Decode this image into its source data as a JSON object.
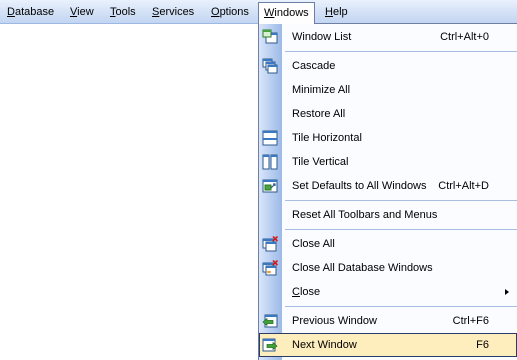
{
  "menubar": {
    "items": [
      {
        "label": "Database",
        "accel": "D",
        "rest": "atabase"
      },
      {
        "label": "View",
        "accel": "V",
        "rest": "iew"
      },
      {
        "label": "Tools",
        "accel": "T",
        "rest": "ools"
      },
      {
        "label": "Services",
        "accel": "S",
        "rest": "ervices"
      },
      {
        "label": "Options",
        "accel": "O",
        "rest": "ptions"
      },
      {
        "label": "Windows",
        "accel": "W",
        "rest": "indows"
      },
      {
        "label": "Help",
        "accel": "H",
        "rest": "elp"
      }
    ]
  },
  "windows_menu": {
    "window_list": {
      "label": "Window List",
      "shortcut": "Ctrl+Alt+0",
      "icon": "window-list-icon"
    },
    "cascade": {
      "label": "Cascade",
      "icon": "cascade-icon"
    },
    "minimize_all": {
      "label": "Minimize All"
    },
    "restore_all": {
      "label": "Restore All"
    },
    "tile_horizontal": {
      "label": "Tile Horizontal",
      "icon": "tile-horizontal-icon"
    },
    "tile_vertical": {
      "label": "Tile Vertical",
      "icon": "tile-vertical-icon"
    },
    "set_defaults": {
      "label": "Set Defaults to All Windows",
      "shortcut": "Ctrl+Alt+D",
      "icon": "set-defaults-icon"
    },
    "reset_toolbars": {
      "label": "Reset All Toolbars and Menus"
    },
    "close_all": {
      "label": "Close All",
      "icon": "close-all-icon"
    },
    "close_all_db": {
      "label": "Close All Database Windows",
      "icon": "close-all-database-icon"
    },
    "close": {
      "label": "Close",
      "accel": "C",
      "rest": "lose"
    },
    "previous_window": {
      "label": "Previous Window",
      "shortcut": "Ctrl+F6",
      "icon": "previous-window-icon"
    },
    "next_window": {
      "label": "Next Window",
      "shortcut": "F6",
      "icon": "next-window-icon"
    }
  },
  "colors": {
    "highlight_bg": "#ffeebd",
    "gutter": "#b7cdf0",
    "menubar": "#d3e1f6"
  }
}
